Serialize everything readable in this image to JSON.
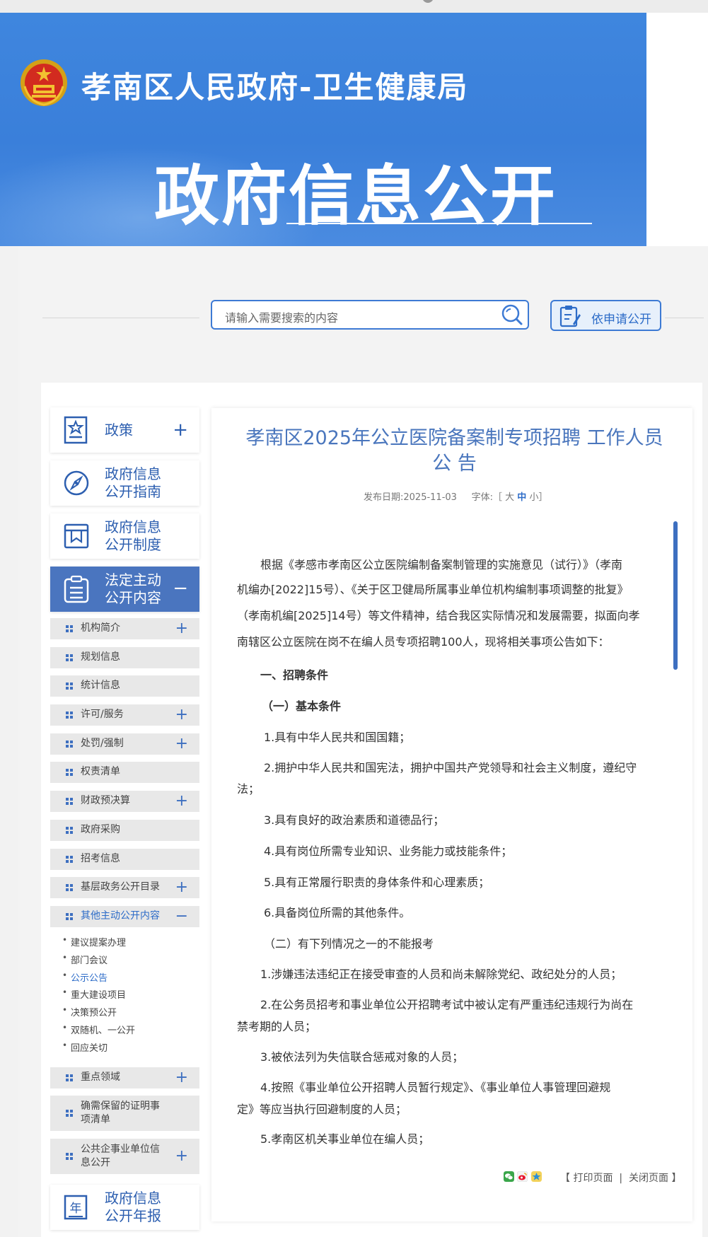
{
  "header": {
    "site_title": "孝南区人民政府-卫生健康局",
    "banner_title": "政府信息公开",
    "emblem_icon": "national-emblem-icon"
  },
  "search": {
    "placeholder": "请输入需要搜索的内容",
    "button_icon": "search-icon",
    "apply_label": "依申请公开"
  },
  "sidebar": {
    "big_items": [
      {
        "label": "政策",
        "icon": "policy-icon",
        "toggle": "+"
      },
      {
        "label": "政府信息\n公开指南",
        "icon": "compass-icon"
      },
      {
        "label": "政府信息\n公开制度",
        "icon": "book-icon"
      },
      {
        "label": "法定主动\n公开内容",
        "icon": "clipboard-icon",
        "toggle": "−"
      }
    ],
    "small_items": [
      {
        "label": "机构简介",
        "toggle": "+"
      },
      {
        "label": "规划信息"
      },
      {
        "label": "统计信息"
      },
      {
        "label": "许可/服务",
        "toggle": "+"
      },
      {
        "label": "处罚/强制",
        "toggle": "+"
      },
      {
        "label": "权责清单"
      },
      {
        "label": "财政预决算",
        "toggle": "+"
      },
      {
        "label": "政府采购"
      },
      {
        "label": "招考信息"
      },
      {
        "label": "基层政务公开目录",
        "toggle": "+"
      },
      {
        "label": "其他主动公开内容",
        "toggle": "−"
      }
    ],
    "sub_items": [
      "建议提案办理",
      "部门会议",
      "公示公告",
      "重大建设项目",
      "决策预公开",
      "双随机、一公开",
      "回应关切"
    ],
    "lower_items": [
      {
        "label": "重点领域",
        "toggle": "+"
      },
      {
        "label": "确需保留的证明事\n项清单"
      },
      {
        "label": "公共企事业单位信\n息公开",
        "toggle": "+"
      }
    ],
    "annual_report": {
      "label": "政府信息\n公开年报",
      "icon": "annual-report-icon"
    }
  },
  "article": {
    "title": "孝南区2025年公立医院备案制专项招聘 工作人员 公 告",
    "date_label": "发布日期:2025-11-03",
    "font_label": "字体:［",
    "font_large": "大",
    "font_medium": "中",
    "font_small": "小",
    "font_close": "］",
    "paragraphs": [
      "根据《孝感市孝南区公立医院编制备案制管理的实施意见（试行）》（孝南",
      "机编办[2022]15号）、《关于区卫健局所属事业单位机构编制事项调整的批复》",
      "（孝南机编[2025]14号）等文件精神，结合我区实际情况和发展需要，拟面向孝",
      "南辖区公立医院在岗不在编人员专项招聘100人，现将相关事项公告如下：",
      "一、招聘条件",
      "（一）基本条件",
      "1.具有中华人民共和国国籍；",
      "2.拥护中华人民共和国宪法，拥护中国共产党领导和社会主义制度，遵纪守",
      "法；",
      "3.具有良好的政治素质和道德品行；",
      "4.具有岗位所需专业知识、业务能力或技能条件；",
      "5.具有正常履行职责的身体条件和心理素质；",
      "6.具备岗位所需的其他条件。",
      "（二）有下列情况之一的不能报考",
      "1.涉嫌违法违纪正在接受审查的人员和尚未解除党纪、政纪处分的人员；",
      "2.在公务员招考和事业单位公开招聘考试中被认定有严重违纪违规行为尚在",
      "禁考期的人员；",
      "3.被依法列为失信联合惩戒对象的人员；",
      "4.按照《事业单位公开招聘人员暂行规定》、《事业单位人事管理回避规",
      "定》等应当执行回避制度的人员；",
      "5.孝南区机关事业单位在编人员；"
    ],
    "tools": {
      "open": "【",
      "print": "打印页面",
      "sep": "|",
      "close_page": "关闭页面",
      "end": "】"
    },
    "share_icons": [
      "wechat-share-icon",
      "weibo-share-icon",
      "qzone-share-icon"
    ]
  },
  "colors": {
    "banner_blue": "#3f86de",
    "accent_blue": "#2d6cc8",
    "active_nav": "#4a75bf"
  }
}
